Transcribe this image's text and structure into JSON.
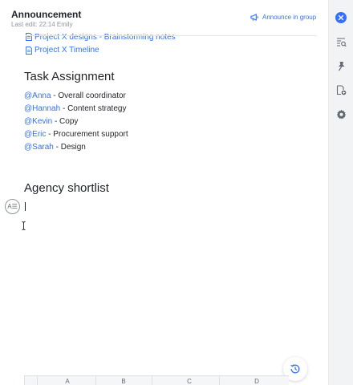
{
  "header": {
    "title": "Announcement",
    "subtitle": "Last edit: 22:14 Emily",
    "announce_label": "Announce in group"
  },
  "doc": {
    "links": [
      {
        "label": "Project X designs - Brainstorming notes"
      },
      {
        "label": "Project X Timeline"
      }
    ],
    "task_heading": "Task Assignment",
    "assignments": [
      {
        "mention": "@Anna",
        "role": " - Overall coordinator"
      },
      {
        "mention": "@Hannah",
        "role": " - Content strategy"
      },
      {
        "mention": "@Kevin",
        "role": " - Copy"
      },
      {
        "mention": "@Eric",
        "role": " - Procurement support"
      },
      {
        "mention": "@Sarah",
        "role": " - Design"
      }
    ],
    "agency_heading": "Agency shortlist",
    "block_handle_label": "A☰"
  },
  "grid": {
    "columns": [
      "A",
      "B",
      "C",
      "D"
    ]
  },
  "icons": {
    "announce": "megaphone-icon",
    "doc": "document-icon",
    "history": "history-icon",
    "rail": [
      "close-icon",
      "search-list-icon",
      "pin-icon",
      "add-document-icon",
      "gear-icon"
    ]
  },
  "colors": {
    "accent": "#3370ff",
    "text": "#1f2329",
    "muted": "#8f959e",
    "rail_bg": "#f2f3f5"
  }
}
